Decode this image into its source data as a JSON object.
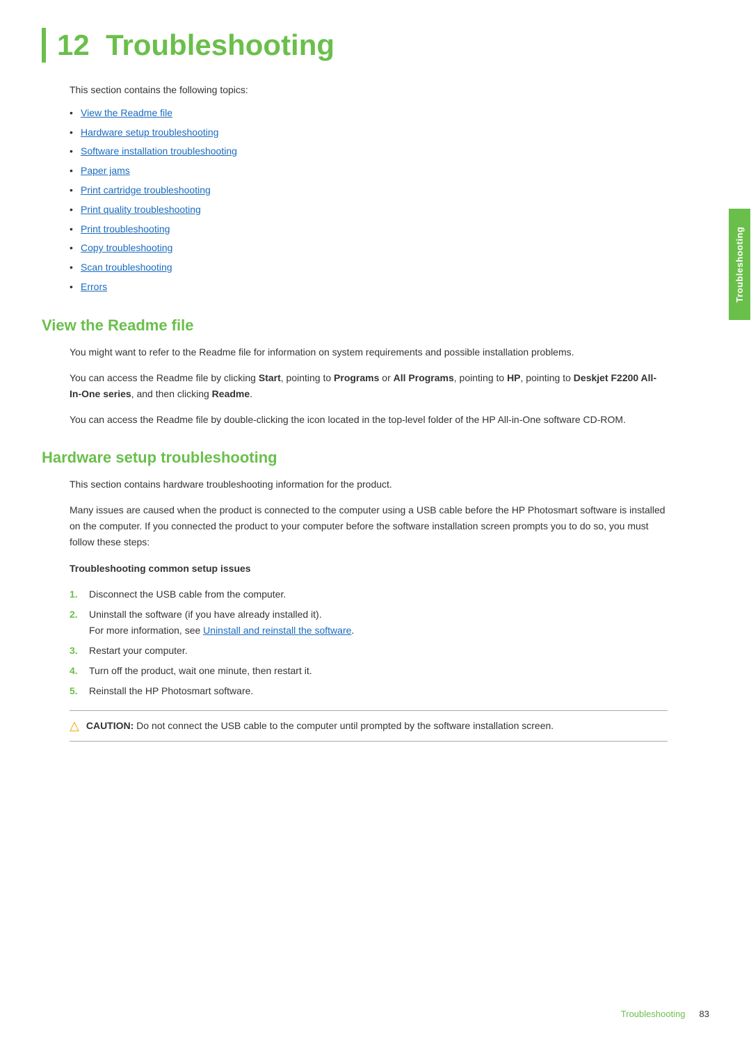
{
  "page": {
    "chapter_number": "12",
    "chapter_title": "Troubleshooting",
    "side_tab_label": "Troubleshooting",
    "footer_label": "Troubleshooting",
    "footer_page": "83"
  },
  "intro": {
    "text": "This section contains the following topics:"
  },
  "topics": [
    {
      "label": "View the Readme file",
      "link": true
    },
    {
      "label": "Hardware setup troubleshooting",
      "link": true
    },
    {
      "label": "Software installation troubleshooting",
      "link": true
    },
    {
      "label": "Paper jams",
      "link": true
    },
    {
      "label": "Print cartridge troubleshooting",
      "link": true
    },
    {
      "label": "Print quality troubleshooting",
      "link": true
    },
    {
      "label": "Print troubleshooting",
      "link": true
    },
    {
      "label": "Copy troubleshooting",
      "link": true
    },
    {
      "label": "Scan troubleshooting",
      "link": true
    },
    {
      "label": "Errors",
      "link": true
    }
  ],
  "section1": {
    "heading": "View the Readme file",
    "para1": "You might want to refer to the Readme file for information on system requirements and possible installation problems.",
    "para2_before": "You can access the Readme file by clicking ",
    "para2_bold1": "Start",
    "para2_mid1": ", pointing to ",
    "para2_bold2": "Programs",
    "para2_mid2": " or ",
    "para2_bold3": "All Programs",
    "para2_mid3": ", pointing to ",
    "para2_bold4": "HP",
    "para2_mid4": ", pointing to ",
    "para2_bold5": "Deskjet F2200 All-In-One series",
    "para2_mid5": ", and then clicking ",
    "para2_bold6": "Readme",
    "para2_end": ".",
    "para3": "You can access the Readme file by double-clicking the icon located in the top-level folder of the HP All-in-One software CD-ROM."
  },
  "section2": {
    "heading": "Hardware setup troubleshooting",
    "para1": "This section contains hardware troubleshooting information for the product.",
    "para2": "Many issues are caused when the product is connected to the computer using a USB cable before the HP Photosmart software is installed on the computer. If you connected the product to your computer before the software installation screen prompts you to do so, you must follow these steps:",
    "subsection_title": "Troubleshooting common setup issues",
    "steps": [
      {
        "num": "1.",
        "text": "Disconnect the USB cable from the computer."
      },
      {
        "num": "2.",
        "text_before": "Uninstall the software (if you have already installed it).",
        "text_line2_before": "For more information, see ",
        "link_text": "Uninstall and reinstall the software",
        "text_line2_after": ".",
        "has_link": true
      },
      {
        "num": "3.",
        "text": "Restart your computer."
      },
      {
        "num": "4.",
        "text": "Turn off the product, wait one minute, then restart it."
      },
      {
        "num": "5.",
        "text": "Reinstall the HP Photosmart software."
      }
    ],
    "caution_label": "CAUTION:",
    "caution_text": "Do not connect the USB cable to the computer until prompted by the software installation screen."
  }
}
